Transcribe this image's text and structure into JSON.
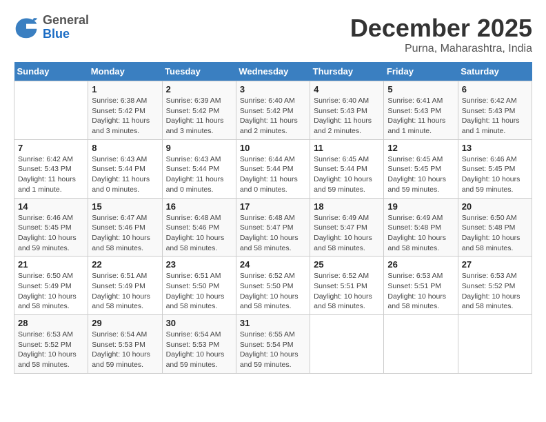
{
  "logo": {
    "general": "General",
    "blue": "Blue"
  },
  "title": "December 2025",
  "subtitle": "Purna, Maharashtra, India",
  "days_of_week": [
    "Sunday",
    "Monday",
    "Tuesday",
    "Wednesday",
    "Thursday",
    "Friday",
    "Saturday"
  ],
  "weeks": [
    [
      {
        "day": "",
        "sunrise": "",
        "sunset": "",
        "daylight": ""
      },
      {
        "day": "1",
        "sunrise": "Sunrise: 6:38 AM",
        "sunset": "Sunset: 5:42 PM",
        "daylight": "Daylight: 11 hours and 3 minutes."
      },
      {
        "day": "2",
        "sunrise": "Sunrise: 6:39 AM",
        "sunset": "Sunset: 5:42 PM",
        "daylight": "Daylight: 11 hours and 3 minutes."
      },
      {
        "day": "3",
        "sunrise": "Sunrise: 6:40 AM",
        "sunset": "Sunset: 5:42 PM",
        "daylight": "Daylight: 11 hours and 2 minutes."
      },
      {
        "day": "4",
        "sunrise": "Sunrise: 6:40 AM",
        "sunset": "Sunset: 5:43 PM",
        "daylight": "Daylight: 11 hours and 2 minutes."
      },
      {
        "day": "5",
        "sunrise": "Sunrise: 6:41 AM",
        "sunset": "Sunset: 5:43 PM",
        "daylight": "Daylight: 11 hours and 1 minute."
      },
      {
        "day": "6",
        "sunrise": "Sunrise: 6:42 AM",
        "sunset": "Sunset: 5:43 PM",
        "daylight": "Daylight: 11 hours and 1 minute."
      }
    ],
    [
      {
        "day": "7",
        "sunrise": "Sunrise: 6:42 AM",
        "sunset": "Sunset: 5:43 PM",
        "daylight": "Daylight: 11 hours and 1 minute."
      },
      {
        "day": "8",
        "sunrise": "Sunrise: 6:43 AM",
        "sunset": "Sunset: 5:44 PM",
        "daylight": "Daylight: 11 hours and 0 minutes."
      },
      {
        "day": "9",
        "sunrise": "Sunrise: 6:43 AM",
        "sunset": "Sunset: 5:44 PM",
        "daylight": "Daylight: 11 hours and 0 minutes."
      },
      {
        "day": "10",
        "sunrise": "Sunrise: 6:44 AM",
        "sunset": "Sunset: 5:44 PM",
        "daylight": "Daylight: 11 hours and 0 minutes."
      },
      {
        "day": "11",
        "sunrise": "Sunrise: 6:45 AM",
        "sunset": "Sunset: 5:44 PM",
        "daylight": "Daylight: 10 hours and 59 minutes."
      },
      {
        "day": "12",
        "sunrise": "Sunrise: 6:45 AM",
        "sunset": "Sunset: 5:45 PM",
        "daylight": "Daylight: 10 hours and 59 minutes."
      },
      {
        "day": "13",
        "sunrise": "Sunrise: 6:46 AM",
        "sunset": "Sunset: 5:45 PM",
        "daylight": "Daylight: 10 hours and 59 minutes."
      }
    ],
    [
      {
        "day": "14",
        "sunrise": "Sunrise: 6:46 AM",
        "sunset": "Sunset: 5:45 PM",
        "daylight": "Daylight: 10 hours and 59 minutes."
      },
      {
        "day": "15",
        "sunrise": "Sunrise: 6:47 AM",
        "sunset": "Sunset: 5:46 PM",
        "daylight": "Daylight: 10 hours and 58 minutes."
      },
      {
        "day": "16",
        "sunrise": "Sunrise: 6:48 AM",
        "sunset": "Sunset: 5:46 PM",
        "daylight": "Daylight: 10 hours and 58 minutes."
      },
      {
        "day": "17",
        "sunrise": "Sunrise: 6:48 AM",
        "sunset": "Sunset: 5:47 PM",
        "daylight": "Daylight: 10 hours and 58 minutes."
      },
      {
        "day": "18",
        "sunrise": "Sunrise: 6:49 AM",
        "sunset": "Sunset: 5:47 PM",
        "daylight": "Daylight: 10 hours and 58 minutes."
      },
      {
        "day": "19",
        "sunrise": "Sunrise: 6:49 AM",
        "sunset": "Sunset: 5:48 PM",
        "daylight": "Daylight: 10 hours and 58 minutes."
      },
      {
        "day": "20",
        "sunrise": "Sunrise: 6:50 AM",
        "sunset": "Sunset: 5:48 PM",
        "daylight": "Daylight: 10 hours and 58 minutes."
      }
    ],
    [
      {
        "day": "21",
        "sunrise": "Sunrise: 6:50 AM",
        "sunset": "Sunset: 5:49 PM",
        "daylight": "Daylight: 10 hours and 58 minutes."
      },
      {
        "day": "22",
        "sunrise": "Sunrise: 6:51 AM",
        "sunset": "Sunset: 5:49 PM",
        "daylight": "Daylight: 10 hours and 58 minutes."
      },
      {
        "day": "23",
        "sunrise": "Sunrise: 6:51 AM",
        "sunset": "Sunset: 5:50 PM",
        "daylight": "Daylight: 10 hours and 58 minutes."
      },
      {
        "day": "24",
        "sunrise": "Sunrise: 6:52 AM",
        "sunset": "Sunset: 5:50 PM",
        "daylight": "Daylight: 10 hours and 58 minutes."
      },
      {
        "day": "25",
        "sunrise": "Sunrise: 6:52 AM",
        "sunset": "Sunset: 5:51 PM",
        "daylight": "Daylight: 10 hours and 58 minutes."
      },
      {
        "day": "26",
        "sunrise": "Sunrise: 6:53 AM",
        "sunset": "Sunset: 5:51 PM",
        "daylight": "Daylight: 10 hours and 58 minutes."
      },
      {
        "day": "27",
        "sunrise": "Sunrise: 6:53 AM",
        "sunset": "Sunset: 5:52 PM",
        "daylight": "Daylight: 10 hours and 58 minutes."
      }
    ],
    [
      {
        "day": "28",
        "sunrise": "Sunrise: 6:53 AM",
        "sunset": "Sunset: 5:52 PM",
        "daylight": "Daylight: 10 hours and 58 minutes."
      },
      {
        "day": "29",
        "sunrise": "Sunrise: 6:54 AM",
        "sunset": "Sunset: 5:53 PM",
        "daylight": "Daylight: 10 hours and 59 minutes."
      },
      {
        "day": "30",
        "sunrise": "Sunrise: 6:54 AM",
        "sunset": "Sunset: 5:53 PM",
        "daylight": "Daylight: 10 hours and 59 minutes."
      },
      {
        "day": "31",
        "sunrise": "Sunrise: 6:55 AM",
        "sunset": "Sunset: 5:54 PM",
        "daylight": "Daylight: 10 hours and 59 minutes."
      },
      {
        "day": "",
        "sunrise": "",
        "sunset": "",
        "daylight": ""
      },
      {
        "day": "",
        "sunrise": "",
        "sunset": "",
        "daylight": ""
      },
      {
        "day": "",
        "sunrise": "",
        "sunset": "",
        "daylight": ""
      }
    ]
  ]
}
